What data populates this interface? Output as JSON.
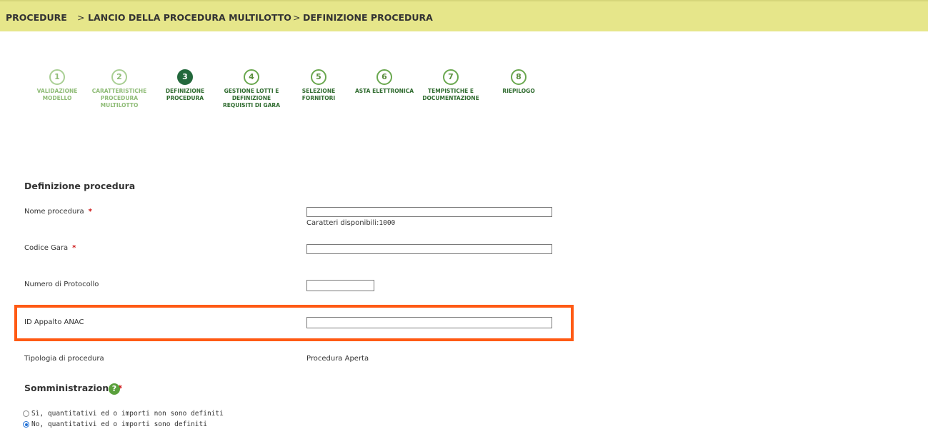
{
  "breadcrumb": {
    "items": [
      "PROCEDURE",
      "LANCIO DELLA PROCEDURA MULTILOTTO",
      "DEFINIZIONE PROCEDURA"
    ],
    "separator": ">"
  },
  "stepper": {
    "steps": [
      {
        "number": "1",
        "label": "VALIDAZIONE\nMODELLO",
        "state": "done"
      },
      {
        "number": "2",
        "label": "CARATTERISTICHE\nPROCEDURA\nMULTILOTTO",
        "state": "done"
      },
      {
        "number": "3",
        "label": "DEFINIZIONE\nPROCEDURA",
        "state": "active"
      },
      {
        "number": "4",
        "label": "GESTIONE LOTTI E\nDEFINIZIONE\nREQUISITI DI GARA",
        "state": "todo"
      },
      {
        "number": "5",
        "label": "SELEZIONE\nFORNITORI",
        "state": "todo"
      },
      {
        "number": "6",
        "label": "ASTA ELETTRONICA",
        "state": "todo"
      },
      {
        "number": "7",
        "label": "TEMPISTICHE E\nDOCUMENTAZIONE",
        "state": "todo"
      },
      {
        "number": "8",
        "label": "RIEPILOGO",
        "state": "todo"
      }
    ]
  },
  "form": {
    "section_title": "Definizione procedura",
    "nome_procedura": {
      "label": "Nome procedura",
      "required_mark": "*",
      "value": "",
      "hint_prefix": "Caratteri disponibili:",
      "hint_count": "1000"
    },
    "codice_gara": {
      "label": "Codice Gara",
      "required_mark": "*",
      "value": ""
    },
    "numero_protocollo": {
      "label": "Numero di Protocollo",
      "value": ""
    },
    "id_appalto_anac": {
      "label": "ID Appalto ANAC",
      "value": ""
    },
    "tipologia": {
      "label": "Tipologia di procedura",
      "value": "Procedura Aperta"
    },
    "somministrazione": {
      "title": "Somministrazione",
      "required_mark": "*",
      "help_icon": "question-mark",
      "options": [
        {
          "label": "Sì, quantitativi ed o importi non sono definiti",
          "checked": false
        },
        {
          "label": "No, quantitativi ed o importi sono definiti",
          "checked": true
        }
      ]
    }
  },
  "colors": {
    "breadcrumb_bg": "#e6e68a",
    "highlight_border": "#ff5a14",
    "active_step": "#23683c",
    "required": "#cc1111"
  }
}
